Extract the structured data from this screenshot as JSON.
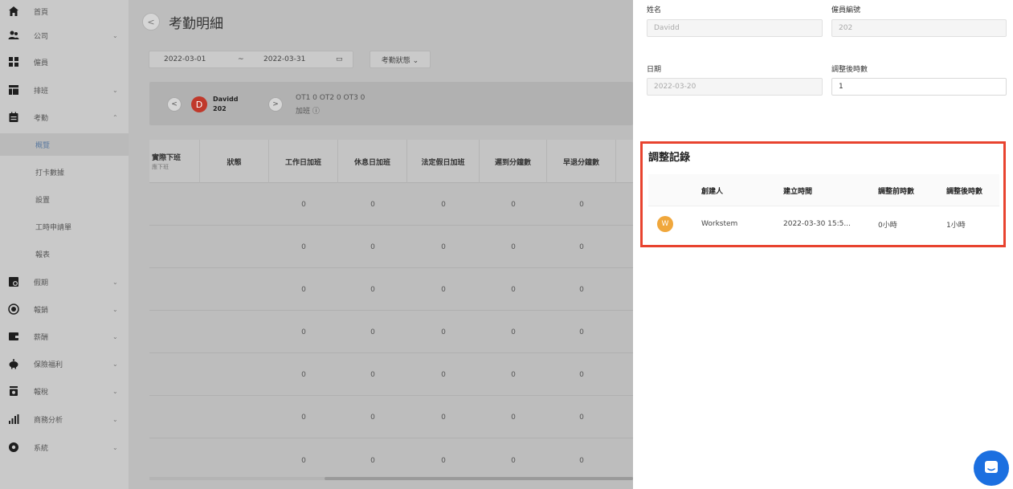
{
  "sidebar": {
    "items": [
      {
        "label": "首頁",
        "icon": "home-icon"
      },
      {
        "label": "公司",
        "icon": "users-icon",
        "chevron": "⌄"
      },
      {
        "label": "僱員",
        "icon": "grid-icon"
      },
      {
        "label": "排班",
        "icon": "table-icon",
        "chevron": "⌄"
      },
      {
        "label": "考勤",
        "icon": "calendar-icon",
        "chevron": "⌃"
      },
      {
        "label": "假期",
        "icon": "leave-icon",
        "chevron": "⌄"
      },
      {
        "label": "報銷",
        "icon": "target-icon",
        "chevron": "⌄"
      },
      {
        "label": "薪酬",
        "icon": "wallet-icon",
        "chevron": "⌄"
      },
      {
        "label": "保險福利",
        "icon": "piggy-bank-icon",
        "chevron": "⌄"
      },
      {
        "label": "報稅",
        "icon": "tax-icon",
        "chevron": "⌄"
      },
      {
        "label": "商務分析",
        "icon": "bar-chart-icon",
        "chevron": "⌄"
      },
      {
        "label": "系統",
        "icon": "gear-icon",
        "chevron": "⌄"
      }
    ],
    "sub_items": [
      {
        "label": "概覽"
      },
      {
        "label": "打卡數據"
      },
      {
        "label": "設置"
      },
      {
        "label": "工時申請單"
      },
      {
        "label": "報表"
      }
    ]
  },
  "main": {
    "back_glyph": "<",
    "title": "考勤明細",
    "date_start": "2022-03-01",
    "date_sep": "~",
    "date_end": "2022-03-31",
    "calendar_glyph": "▭",
    "status_filter": "考勤狀態 ⌄",
    "employee": {
      "prev_glyph": "<",
      "next_glyph": ">",
      "initial": "D",
      "name": "Davidd",
      "id": "202",
      "ot_summary": "OT1 0 OT2 0 OT3 0",
      "ot_label": "加班 ⓘ"
    },
    "table": {
      "first_col": {
        "label": "實際下班",
        "sub": "應下班"
      },
      "columns": [
        "狀態",
        "工作日加班",
        "休息日加班",
        "法定假日加班",
        "遲到分鐘數",
        "早退分鐘數"
      ],
      "rows": [
        [
          "",
          "0",
          "0",
          "0",
          "0",
          "0"
        ],
        [
          "",
          "0",
          "0",
          "0",
          "0",
          "0"
        ],
        [
          "",
          "0",
          "0",
          "0",
          "0",
          "0"
        ],
        [
          "",
          "0",
          "0",
          "0",
          "0",
          "0"
        ],
        [
          "",
          "0",
          "0",
          "0",
          "0",
          "0"
        ],
        [
          "",
          "0",
          "0",
          "0",
          "0",
          "0"
        ],
        [
          "",
          "0",
          "0",
          "0",
          "0",
          "0"
        ]
      ]
    }
  },
  "panel": {
    "name_label": "姓名",
    "name_value": "Davidd",
    "emp_no_label": "僱員編號",
    "emp_no_value": "202",
    "date_label": "日期",
    "date_value": "2022-03-20",
    "adjusted_hours_label": "調整後時數",
    "adjusted_hours_value": "1",
    "records": {
      "title": "調整記錄",
      "headers": [
        "創建人",
        "建立時間",
        "調整前時數",
        "調整後時數"
      ],
      "rows": [
        {
          "initial": "W",
          "creator": "Workstem",
          "created_at": "2022-03-30 15:5...",
          "before": "0小時",
          "after": "1小時"
        }
      ]
    }
  },
  "colors": {
    "highlight_border": "#e8432f",
    "avatar_employee": "#c0392b",
    "avatar_creator": "#f0a73c",
    "chat_button": "#1b6fe0"
  }
}
